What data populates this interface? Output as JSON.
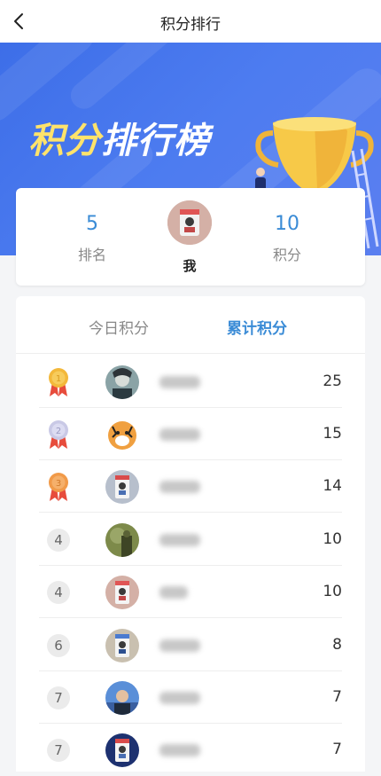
{
  "header": {
    "title": "积分排行"
  },
  "banner": {
    "title_part1": "积分",
    "title_part2": "排行榜"
  },
  "me": {
    "rank": "5",
    "rank_label": "排名",
    "name": "我",
    "points": "10",
    "points_label": "积分"
  },
  "tabs": [
    {
      "label": "今日积分",
      "active": false
    },
    {
      "label": "累计积分",
      "active": true
    }
  ],
  "rows": [
    {
      "rank": "1",
      "medal": "gold",
      "score": "25"
    },
    {
      "rank": "2",
      "medal": "silver",
      "score": "15"
    },
    {
      "rank": "3",
      "medal": "bronze",
      "score": "14"
    },
    {
      "rank": "4",
      "score": "10"
    },
    {
      "rank": "4",
      "score": "10"
    },
    {
      "rank": "6",
      "score": "8"
    },
    {
      "rank": "7",
      "score": "7"
    },
    {
      "rank": "7",
      "score": "7"
    }
  ],
  "colors": {
    "accent": "#3a8bd6",
    "banner": "#4d7cf0",
    "gold": "#f3b83a",
    "silver": "#c9c9e6",
    "bronze": "#f19a49",
    "ribbon": "#e74c3c"
  }
}
